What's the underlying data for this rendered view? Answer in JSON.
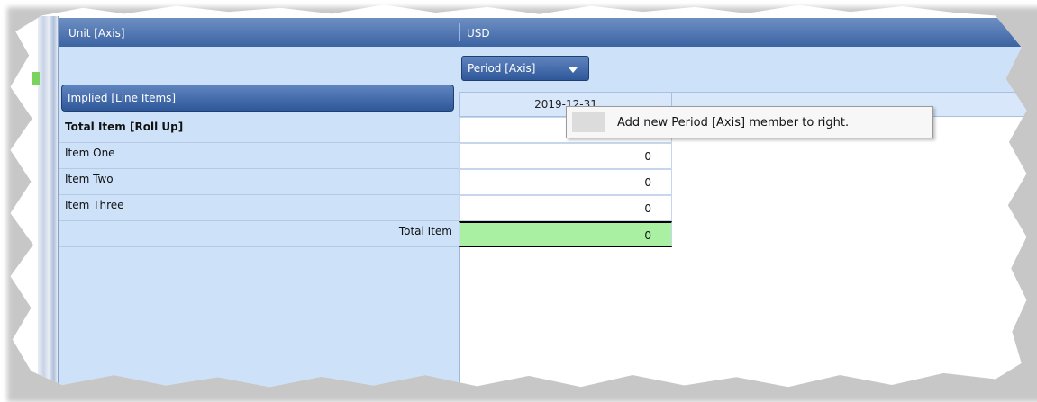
{
  "header": {
    "unit_axis_label": "Unit [Axis]",
    "unit_value": "USD"
  },
  "columns": {
    "period_axis_button": "Period [Axis]",
    "period_header": "2019-12-31"
  },
  "rows_axis": {
    "implied_button": "Implied [Line Items]"
  },
  "rows": [
    {
      "label": "Total Item [Roll Up]",
      "value": ""
    },
    {
      "label": "Item One",
      "value": "0"
    },
    {
      "label": "Item Two",
      "value": "0"
    },
    {
      "label": "Item Three",
      "value": "0"
    },
    {
      "label": "Total Item",
      "value": "0"
    }
  ],
  "tooltip": {
    "text": "Add new Period [Axis] member to right."
  },
  "colors": {
    "header_blue": "#3c63a3",
    "panel_blue": "#cde1f8",
    "total_green": "#a9f0a2"
  }
}
